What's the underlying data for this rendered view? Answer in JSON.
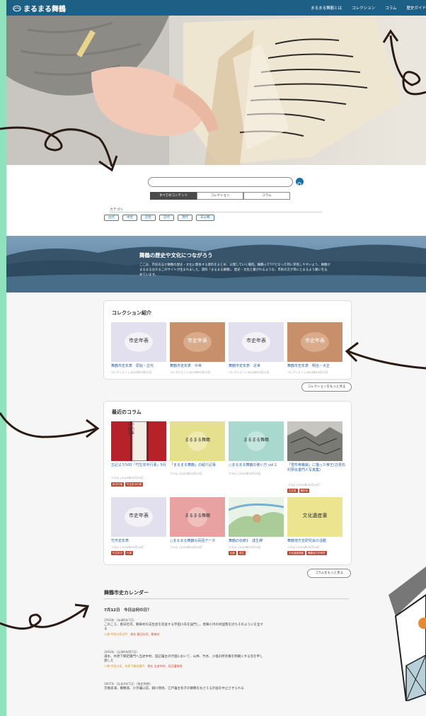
{
  "site": {
    "name": "まるまる舞鶴"
  },
  "nav": [
    "まるまる舞鶴とは",
    "コレクション",
    "コラム",
    "歴史ガイド"
  ],
  "search": {
    "placeholder": ""
  },
  "tabs": [
    "すべてのコンテンツ",
    "コレクション",
    "コラム"
  ],
  "category": {
    "label": "カテゴリ",
    "chips": [
      "古代",
      "中世",
      "近世",
      "近代",
      "現代",
      "未分類"
    ]
  },
  "banner": {
    "title": "舞鶴の歴史や文化につながろう",
    "body": "ここは、市民有志が舞鶴の歴史・文化に関係する資料をまとめ、公開していく場所。舞鶴って???となった時に参照しやすいよう、舞鶴がまるまる分かるこのサイトが生まれました。資料「まるまる舞鶴」、歴史・文化と繋がれるような、市民の方が目にとまるよう願いを込めています。"
  },
  "collection": {
    "title": "コレクション紹介",
    "items": [
      {
        "title": "舞鶴市史年表　原始・古代",
        "meta": "コレクション | 2024年05月15日",
        "thumb_text": "市史年表",
        "bg": "#e2e0ee",
        "color": "#333333"
      },
      {
        "title": "舞鶴市史年表　中世",
        "meta": "コレクション | 2024年05月15日",
        "thumb_text": "市史年表",
        "bg": "#c7906b",
        "color": "#ffffff"
      },
      {
        "title": "舞鶴市史年表　近世",
        "meta": "コレクション | 2024年05月15日",
        "thumb_text": "市史年表",
        "bg": "#e2e0ee",
        "color": "#333333"
      },
      {
        "title": "舞鶴市史年表　明治・大正",
        "meta": "コレクション | 2024年05月15日",
        "thumb_text": "市史年表",
        "bg": "#c7906b",
        "color": "#ffffff"
      }
    ],
    "more_label": "コレクションをもっと見る"
  },
  "columns": {
    "title": "最近のコラム",
    "items": [
      {
        "title": "古記より500「竹生年中行事」5月",
        "meta": "コラム | 2024年05月15日",
        "tags": [
          "年中行事",
          "竹生年中行事"
        ],
        "thumb_text": "みやまの行事",
        "kind": "red"
      },
      {
        "title": "「まるまる舞鶴」の紹介記事",
        "meta": "コラム | 2024年05月15日",
        "tags": [],
        "thumb_text": "まるまる舞鶴",
        "kind": "yellow"
      },
      {
        "title": "○まるまる舞鶴の使い方 vol.1",
        "meta": "コラム | 2024年05月15日",
        "tags": [],
        "thumb_text": "まるまる舞鶴",
        "kind": "teal"
      },
      {
        "title": "「雪形帝義録」に描った帝王(辺見石村夢伝書門人写真集)",
        "meta": "コラム | 2024年05月15日",
        "tags": [
          "古文書",
          "雪形帝"
        ],
        "thumb_text": "",
        "kind": "sketch"
      },
      {
        "title": "竹市史年表",
        "meta": "コラム | 2024年05月15日",
        "tags": [
          "竹生年中",
          "行事"
        ],
        "thumb_text": "市史年表",
        "kind": "lavender"
      },
      {
        "title": "○まるまる舞鶴の百回データ",
        "meta": "コラム | 2024年05月15日",
        "tags": [],
        "thumb_text": "まるまる舞鶴",
        "kind": "pink"
      },
      {
        "title": "舞鶴の伝統1　成生岬",
        "meta": "コラム | 2024年05月15日",
        "tags": [
          "伝統",
          "成生"
        ],
        "thumb_text": "",
        "kind": "map"
      },
      {
        "title": "舞鶴地方史研究会の活動",
        "meta": "コラム | 2024年05月15日",
        "tags": [
          "文化遺産調査",
          "舞鶴地方史研究"
        ],
        "thumb_text": "文化遺産書",
        "kind": "yellow2"
      }
    ],
    "more_label": "コラムをもっと見る"
  },
  "calendar": {
    "title": "舞鶴市史カレンダー",
    "date": "7月12日　今日は何の日？",
    "events": [
      {
        "year": "1563年（永禄6年7月）",
        "text": "このころ、春日社司、朝来村の志生屋を巡査する宇田川氏を誤門し、恵陣小浜の村国勢を討ちそのようにを呈する",
        "tags": [
          "人物 宇田川家光門",
          "地名 春日社司、朝来村"
        ]
      },
      {
        "year": "1693年（元禄6年閏7月）",
        "text": "湯水、木原下郷定康門へ当述中村、田辺藩主の代理において、山林、竹木、小塩の所有権を明確にする旨を申し渡した",
        "tags": [
          "人物 宇田川氏、木原下郷定康門",
          "地名 当述中村、田辺藩領地"
        ]
      },
      {
        "year": "1847年（弘化4年7月）（推定時期）",
        "text": "京極高浦、舞鶴城、小浜藩以前、鎮川領地、江戸藩主有子の舞鶴をおさえる計画を中止させられる",
        "tags": []
      }
    ]
  }
}
